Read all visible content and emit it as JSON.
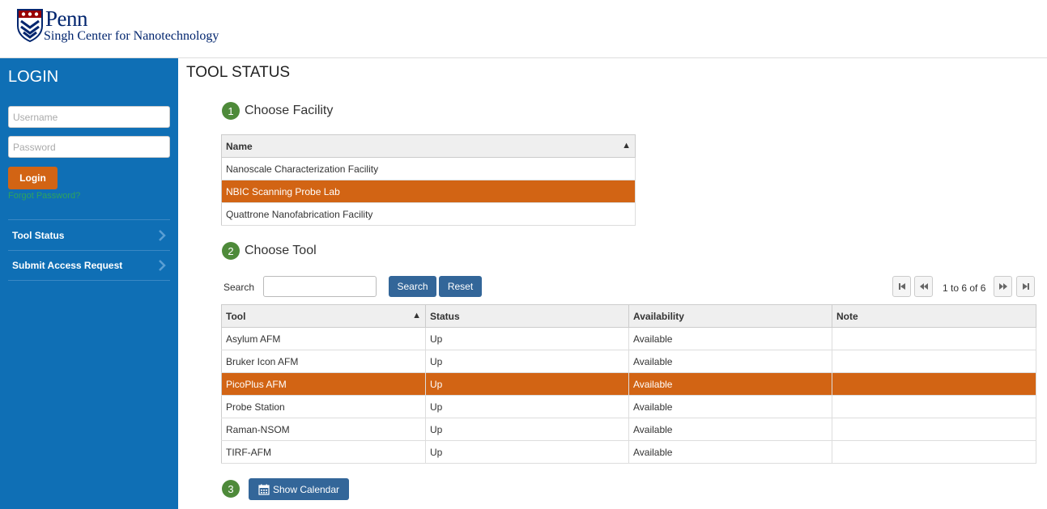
{
  "header": {
    "logo_main": "Penn",
    "logo_sub": "Singh Center for Nanotechnology"
  },
  "sidebar": {
    "login_title": "LOGIN",
    "username_placeholder": "Username",
    "password_placeholder": "Password",
    "login_label": "Login",
    "forgot_label": "Forgot Password?",
    "nav": [
      {
        "label": "Tool Status"
      },
      {
        "label": "Submit Access Request"
      }
    ]
  },
  "main": {
    "title": "TOOL STATUS",
    "step1": {
      "num": "1",
      "label": "Choose Facility"
    },
    "step2": {
      "num": "2",
      "label": "Choose Tool"
    },
    "step3": {
      "num": "3"
    },
    "facility": {
      "header": "Name",
      "rows": [
        "Nanoscale Characterization Facility",
        "NBIC Scanning Probe Lab",
        "Quattrone Nanofabrication Facility"
      ]
    },
    "search_label": "Search",
    "search_value": "",
    "search_btn": "Search",
    "reset_btn": "Reset",
    "pager_text": "1 to 6 of 6",
    "tools": {
      "headers": [
        "Tool",
        "Status",
        "Availability",
        "Note"
      ],
      "rows": [
        [
          "Asylum AFM",
          "Up",
          "Available",
          ""
        ],
        [
          "Bruker Icon AFM",
          "Up",
          "Available",
          ""
        ],
        [
          "PicoPlus AFM",
          "Up",
          "Available",
          ""
        ],
        [
          "Probe Station",
          "Up",
          "Available",
          ""
        ],
        [
          "Raman-NSOM",
          "Up",
          "Available",
          ""
        ],
        [
          "TIRF-AFM",
          "Up",
          "Available",
          ""
        ]
      ]
    },
    "calendar_btn": "Show Calendar"
  },
  "colors": {
    "sidebar_bg": "#0f6fb5",
    "accent_orange": "#d26414",
    "button_blue": "#336699",
    "step_green": "#4e8a3a",
    "penn_navy": "#01256e"
  }
}
